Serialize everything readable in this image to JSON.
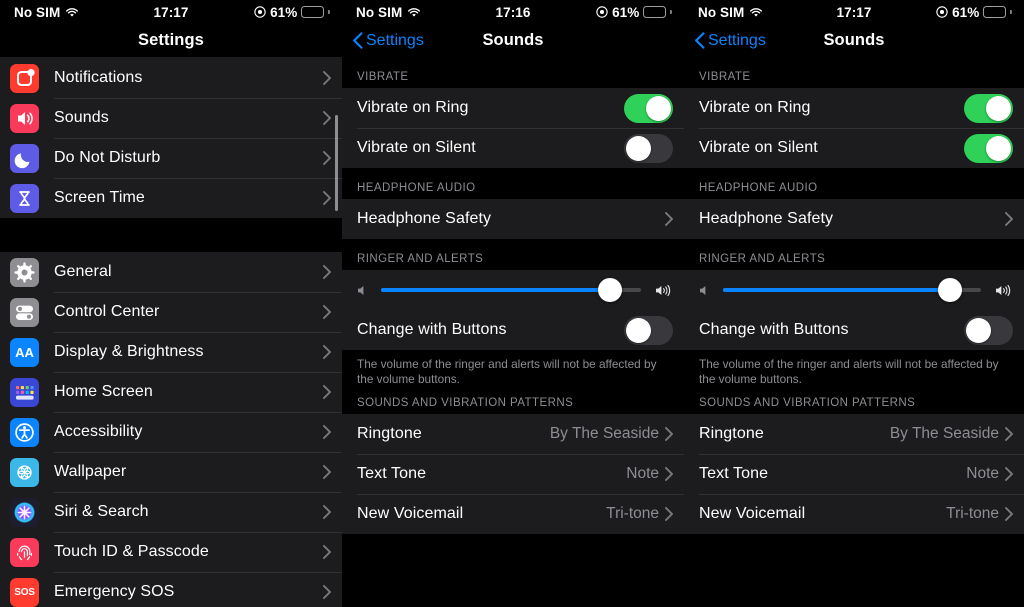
{
  "panels": {
    "left": {
      "status": {
        "carrier": "No SIM",
        "time": "17:17",
        "battery": "61%",
        "battery_level": 61,
        "wifi_icon": "wifi-icon",
        "location_icon": "location-services-icon",
        "battery_icon": "battery-icon"
      },
      "nav": {
        "title": "Settings"
      },
      "groups": [
        {
          "items": [
            {
              "label": "Notifications",
              "icon": "notifications-icon",
              "color": "#ff3b30",
              "chevron": "chevron-right-icon"
            },
            {
              "label": "Sounds",
              "icon": "sounds-icon",
              "color": "#f93a5a",
              "chevron": "chevron-right-icon"
            },
            {
              "label": "Do Not Disturb",
              "icon": "do-not-disturb-icon",
              "color": "#5e5ce6",
              "chevron": "chevron-right-icon"
            },
            {
              "label": "Screen Time",
              "icon": "screen-time-icon",
              "color": "#5e5ce6",
              "chevron": "chevron-right-icon"
            }
          ]
        },
        {
          "items": [
            {
              "label": "General",
              "icon": "general-gear-icon",
              "color": "#8e8e93",
              "chevron": "chevron-right-icon"
            },
            {
              "label": "Control Center",
              "icon": "control-center-icon",
              "color": "#8e8e93",
              "chevron": "chevron-right-icon"
            },
            {
              "label": "Display & Brightness",
              "icon": "display-brightness-icon",
              "color": "#0a84ff",
              "chevron": "chevron-right-icon"
            },
            {
              "label": "Home Screen",
              "icon": "home-screen-icon",
              "color": "#3a47d5",
              "chevron": "chevron-right-icon"
            },
            {
              "label": "Accessibility",
              "icon": "accessibility-icon",
              "color": "#0a84ff",
              "chevron": "chevron-right-icon"
            },
            {
              "label": "Wallpaper",
              "icon": "wallpaper-icon",
              "color": "#3bb8e8",
              "chevron": "chevron-right-icon"
            },
            {
              "label": "Siri & Search",
              "icon": "siri-search-icon",
              "color": "#2a2a40",
              "chevron": "chevron-right-icon"
            },
            {
              "label": "Touch ID & Passcode",
              "icon": "touch-id-passcode-icon",
              "color": "#f93a5a",
              "chevron": "chevron-right-icon"
            },
            {
              "label": "Emergency SOS",
              "icon": "emergency-sos-icon",
              "color": "#ff3b30",
              "chevron": "chevron-right-icon"
            }
          ]
        }
      ],
      "scrollbar": {
        "name": "scrollbar-indicator"
      }
    },
    "mid": {
      "status": {
        "carrier": "No SIM",
        "time": "17:16",
        "battery": "61%",
        "battery_level": 61,
        "wifi_icon": "wifi-icon",
        "location_icon": "location-services-icon",
        "battery_icon": "battery-icon"
      },
      "nav": {
        "back_label": "Settings",
        "title": "Sounds",
        "back_icon": "chevron-left-icon"
      },
      "sections": {
        "vibrate_header": "VIBRATE",
        "vibrate_on_ring": {
          "label": "Vibrate on Ring",
          "state": "on"
        },
        "vibrate_on_silent": {
          "label": "Vibrate on Silent",
          "state": "off"
        },
        "headphone_header": "HEADPHONE AUDIO",
        "headphone_safety": {
          "label": "Headphone Safety",
          "chevron": "chevron-right-icon"
        },
        "ringer_header": "RINGER AND ALERTS",
        "ringer_slider": {
          "value": 88,
          "min_icon": "speaker-low-icon",
          "max_icon": "speaker-high-icon"
        },
        "change_with_buttons": {
          "label": "Change with Buttons",
          "state": "off"
        },
        "footer": "The volume of the ringer and alerts will not be affected by the volume buttons.",
        "patterns_header": "SOUNDS AND VIBRATION PATTERNS",
        "tones": [
          {
            "label": "Ringtone",
            "value": "By The Seaside",
            "chevron": "chevron-right-icon"
          },
          {
            "label": "Text Tone",
            "value": "Note",
            "chevron": "chevron-right-icon"
          },
          {
            "label": "New Voicemail",
            "value": "Tri-tone",
            "chevron": "chevron-right-icon"
          }
        ]
      }
    },
    "right": {
      "status": {
        "carrier": "No SIM",
        "time": "17:17",
        "battery": "61%",
        "battery_level": 61,
        "wifi_icon": "wifi-icon",
        "location_icon": "location-services-icon",
        "battery_icon": "battery-icon"
      },
      "nav": {
        "back_label": "Settings",
        "title": "Sounds",
        "back_icon": "chevron-left-icon"
      },
      "sections": {
        "vibrate_header": "VIBRATE",
        "vibrate_on_ring": {
          "label": "Vibrate on Ring",
          "state": "on"
        },
        "vibrate_on_silent": {
          "label": "Vibrate on Silent",
          "state": "on"
        },
        "headphone_header": "HEADPHONE AUDIO",
        "headphone_safety": {
          "label": "Headphone Safety",
          "chevron": "chevron-right-icon"
        },
        "ringer_header": "RINGER AND ALERTS",
        "ringer_slider": {
          "value": 88,
          "min_icon": "speaker-low-icon",
          "max_icon": "speaker-high-icon"
        },
        "change_with_buttons": {
          "label": "Change with Buttons",
          "state": "off"
        },
        "footer": "The volume of the ringer and alerts will not be affected by the volume buttons.",
        "patterns_header": "SOUNDS AND VIBRATION PATTERNS",
        "tones": [
          {
            "label": "Ringtone",
            "value": "By The Seaside",
            "chevron": "chevron-right-icon"
          },
          {
            "label": "Text Tone",
            "value": "Note",
            "chevron": "chevron-right-icon"
          },
          {
            "label": "New Voicemail",
            "value": "Tri-tone",
            "chevron": "chevron-right-icon"
          }
        ]
      }
    }
  },
  "colors": {
    "accent_blue": "#0a84ff",
    "toggle_on_green": "#30d158",
    "toggle_off": "#39393d",
    "row_bg": "#1c1c1e",
    "separator": "#313134",
    "secondary_text": "#8d8d93"
  }
}
